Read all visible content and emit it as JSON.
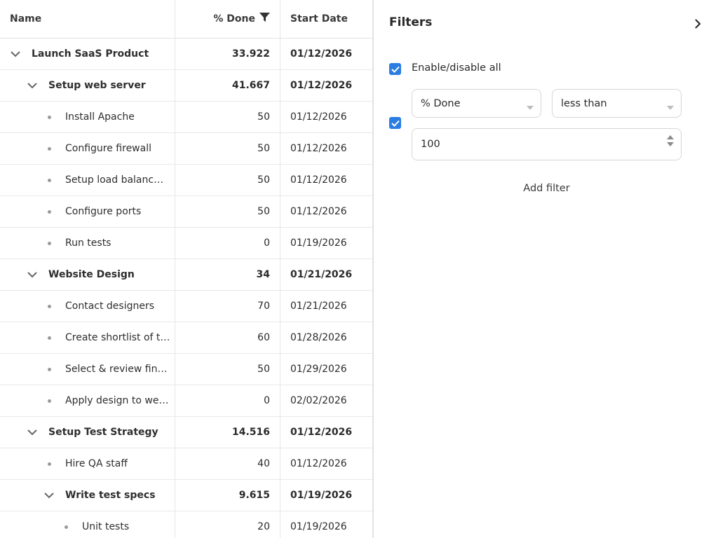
{
  "grid": {
    "headers": {
      "name": "Name",
      "percent_done": "% Done",
      "start_date": "Start Date"
    },
    "rows": [
      {
        "name": "Launch SaaS Product",
        "done": "33.922",
        "date": "01/12/2026",
        "level": 0,
        "parent": true
      },
      {
        "name": "Setup web server",
        "done": "41.667",
        "date": "01/12/2026",
        "level": 1,
        "parent": true
      },
      {
        "name": "Install Apache",
        "done": "50",
        "date": "01/12/2026",
        "level": 2,
        "parent": false
      },
      {
        "name": "Configure firewall",
        "done": "50",
        "date": "01/12/2026",
        "level": 2,
        "parent": false
      },
      {
        "name": "Setup load balanc…",
        "done": "50",
        "date": "01/12/2026",
        "level": 2,
        "parent": false
      },
      {
        "name": "Configure ports",
        "done": "50",
        "date": "01/12/2026",
        "level": 2,
        "parent": false
      },
      {
        "name": "Run tests",
        "done": "0",
        "date": "01/19/2026",
        "level": 2,
        "parent": false
      },
      {
        "name": "Website Design",
        "done": "34",
        "date": "01/21/2026",
        "level": 1,
        "parent": true
      },
      {
        "name": "Contact designers",
        "done": "70",
        "date": "01/21/2026",
        "level": 2,
        "parent": false
      },
      {
        "name": "Create shortlist of t…",
        "done": "60",
        "date": "01/28/2026",
        "level": 2,
        "parent": false
      },
      {
        "name": "Select & review fin…",
        "done": "50",
        "date": "01/29/2026",
        "level": 2,
        "parent": false
      },
      {
        "name": "Apply design to we…",
        "done": "0",
        "date": "02/02/2026",
        "level": 2,
        "parent": false
      },
      {
        "name": "Setup Test Strategy",
        "done": "14.516",
        "date": "01/12/2026",
        "level": 1,
        "parent": true
      },
      {
        "name": "Hire QA staff",
        "done": "40",
        "date": "01/12/2026",
        "level": 2,
        "parent": false
      },
      {
        "name": "Write test specs",
        "done": "9.615",
        "date": "01/19/2026",
        "level": 2,
        "parent": true
      },
      {
        "name": "Unit tests",
        "done": "20",
        "date": "01/19/2026",
        "level": 3,
        "parent": false
      }
    ]
  },
  "filters": {
    "title": "Filters",
    "enable_all_label": "Enable/disable all",
    "enable_all_checked": true,
    "rule": {
      "enabled": true,
      "field": "% Done",
      "operator": "less than",
      "value": "100"
    },
    "add_filter_label": "Add filter"
  },
  "colors": {
    "checkbox": "#2b7de1",
    "border": "#d6d6d6"
  },
  "icons": {
    "toggle": "chevron-down-icon",
    "filter": "filter-icon",
    "close": "chevron-right-icon",
    "leaf": "bullet-icon"
  }
}
